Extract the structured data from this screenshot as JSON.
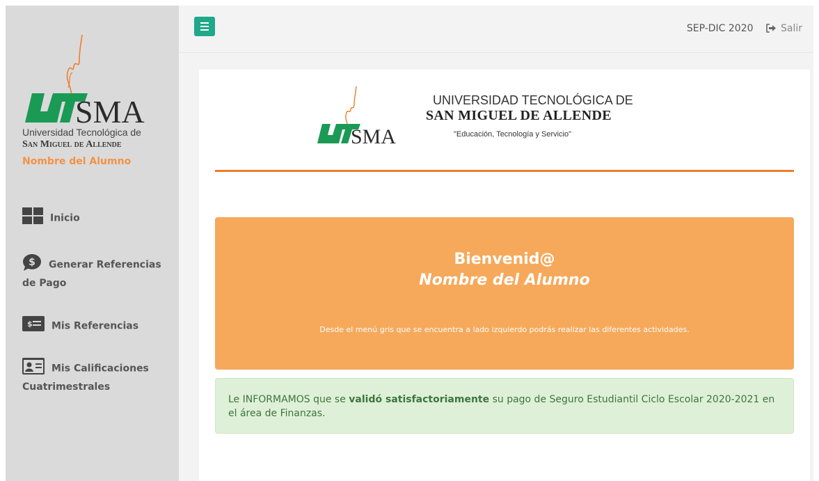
{
  "sidebar": {
    "logo_text": "SMA",
    "university_line1": "Universidad Tecnológica de",
    "university_line2": "San Miguel de Allende",
    "student_name": "Nombre del Alumno",
    "items": [
      {
        "label": "Inicio",
        "icon": "grid-icon"
      },
      {
        "label": "Generar Referencias de Pago",
        "icon": "dollar-bubble-icon"
      },
      {
        "label": "Mis Referencias",
        "icon": "money-card-icon"
      },
      {
        "label": "Mis Calificaciones Cuatrimestrales",
        "icon": "id-card-icon"
      }
    ]
  },
  "topbar": {
    "menu_icon": "hamburger-icon",
    "period": "SEP-DIC 2020",
    "logout_label": "Salir",
    "logout_icon": "sign-out-icon"
  },
  "header": {
    "logo_text": "SMA",
    "line1": "UNIVERSIDAD TECNOLÓGICA DE",
    "line2": "SAN MIGUEL DE ALLENDE",
    "motto": "\"Educación, Tecnología y Servicio\""
  },
  "welcome": {
    "title": "Bienvenid@",
    "name": "Nombre del Alumno",
    "description": "Desde el menú gris que se encuentra a lado izquierdo podrás realizar las diferentes actividades."
  },
  "alert": {
    "prefix": "Le INFORMAMOS que se ",
    "bold": "validó satisfactoriamente",
    "suffix": " su pago de Seguro Estudiantil Ciclo Escolar 2020-2021 en el área de Finanzas."
  },
  "colors": {
    "accent_orange": "#ef7d2a",
    "welcome_bg": "#f6a95b",
    "brand_green": "#1fa88a",
    "alert_bg": "#dff0d8",
    "alert_text": "#3c763d",
    "sidebar_bg": "#dadada"
  }
}
